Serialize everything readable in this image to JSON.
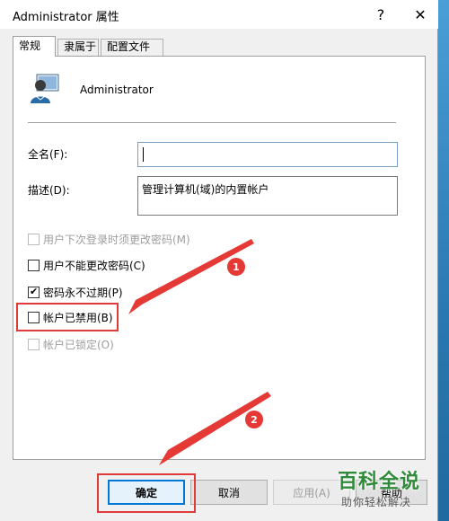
{
  "window": {
    "title": "Administrator 属性",
    "help_glyph": "?",
    "close_glyph": "✕"
  },
  "tabs": [
    {
      "label": "常规",
      "active": true
    },
    {
      "label": "隶属于",
      "active": false
    },
    {
      "label": "配置文件",
      "active": false
    }
  ],
  "general": {
    "user_name": "Administrator",
    "fullname_label": "全名(F):",
    "fullname_value": "",
    "description_label": "描述(D):",
    "description_value": "管理计算机(域)的内置帐户",
    "checkboxes": [
      {
        "label": "用户下次登录时须更改密码(M)",
        "checked": false,
        "enabled": false
      },
      {
        "label": "用户不能更改密码(C)",
        "checked": false,
        "enabled": true
      },
      {
        "label": "密码永不过期(P)",
        "checked": true,
        "enabled": true
      },
      {
        "label": "帐户已禁用(B)",
        "checked": false,
        "enabled": true
      },
      {
        "label": "帐户已锁定(O)",
        "checked": false,
        "enabled": false
      }
    ],
    "checkmark_glyph": "✔"
  },
  "buttons": {
    "ok": "确定",
    "cancel": "取消",
    "apply": "应用(A)",
    "help": "帮助"
  },
  "annotations": {
    "badge_1": "1",
    "badge_2": "2",
    "color": "#e53935"
  },
  "watermark": {
    "title": "百科全说",
    "subtitle": "助你轻松解决"
  }
}
